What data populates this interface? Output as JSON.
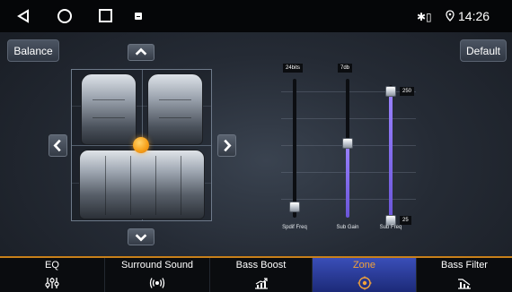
{
  "status_bar": {
    "time": "14:26",
    "bluetooth_icon": "bluetooth-icon",
    "location_icon": "location-icon"
  },
  "buttons": {
    "balance_label": "Balance",
    "default_label": "Default"
  },
  "sliders": {
    "spdif": {
      "top_label": "24bits",
      "bottom_label": "Spdif Freq",
      "level": 0.0
    },
    "sub_gain": {
      "top_label": "7db",
      "bottom_label": "Sub Gain",
      "level": 0.5
    },
    "sub_freq": {
      "bottom_label": "Sub Freq",
      "high_value": "250",
      "low_value": "25",
      "high_level": 1.0,
      "low_level": 0.1
    }
  },
  "tabs": [
    {
      "label": "EQ",
      "icon": "equalizer-icon",
      "active": false
    },
    {
      "label": "Surround Sound",
      "icon": "surround-sound-icon",
      "active": false
    },
    {
      "label": "Bass Boost",
      "icon": "bass-boost-icon",
      "active": false
    },
    {
      "label": "Zone",
      "icon": "zone-target-icon",
      "active": true
    },
    {
      "label": "Bass Filter",
      "icon": "bass-filter-icon",
      "active": false
    }
  ],
  "colors": {
    "accent": "#f2a23a",
    "active_tab": "#2f43a8",
    "slider_fill": "#8a72f0",
    "focus_dot": "#f7a21c"
  }
}
